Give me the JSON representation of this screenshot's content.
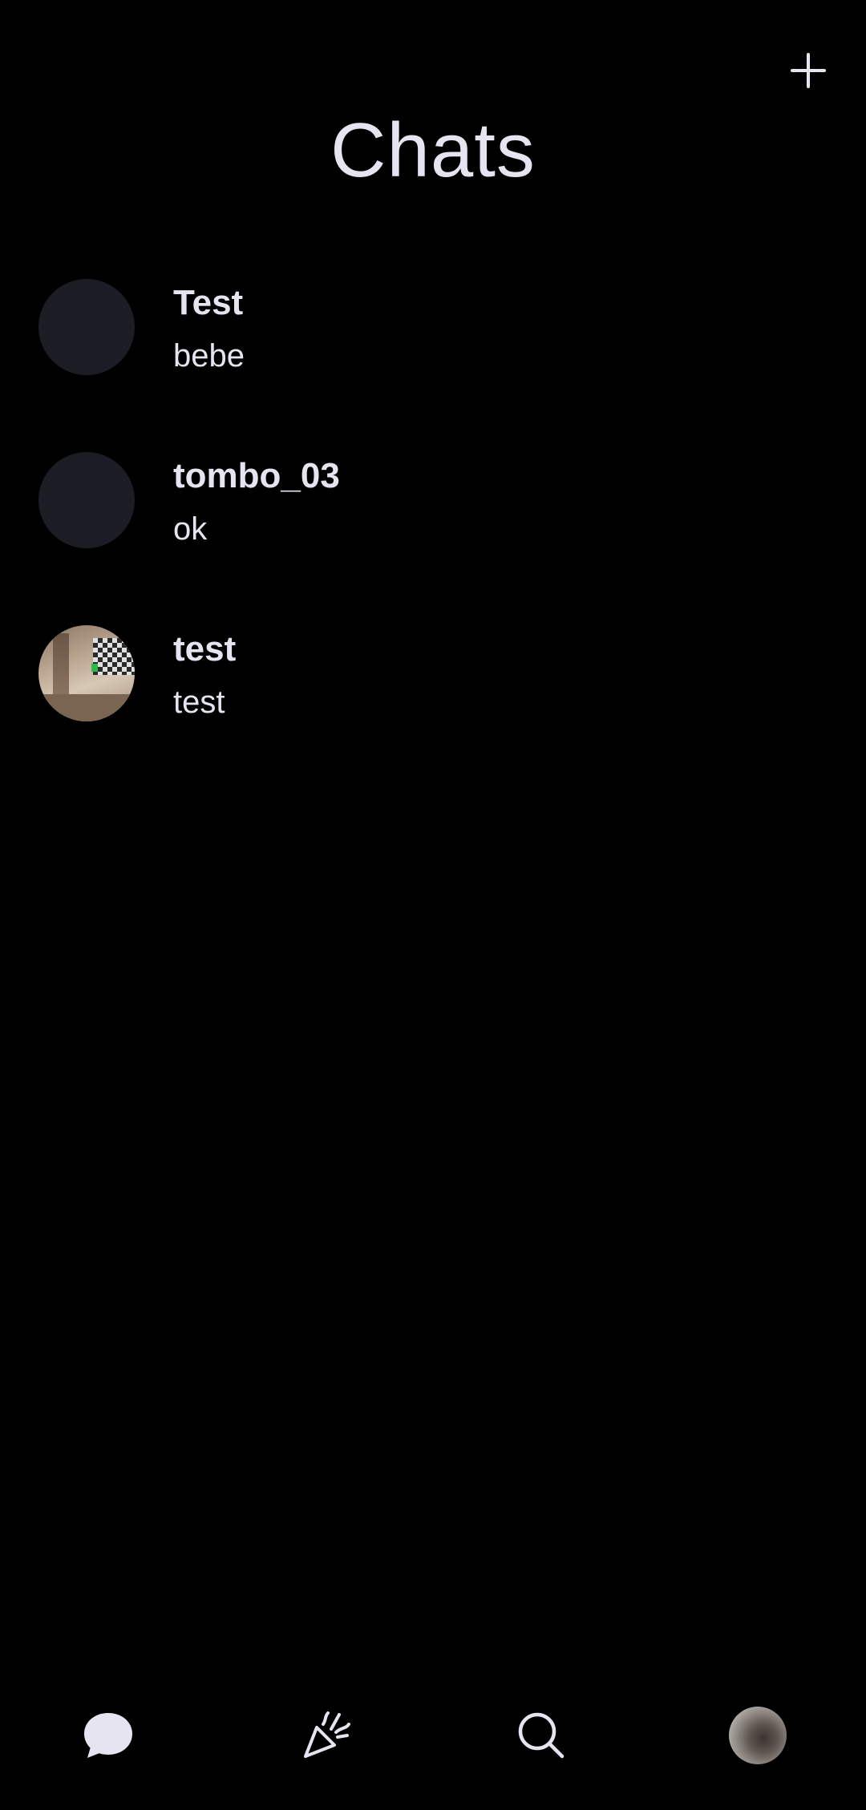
{
  "header": {
    "title": "Chats",
    "add_icon": "plus-icon"
  },
  "chats": [
    {
      "name": "Test",
      "preview": "bebe",
      "avatar": "placeholder"
    },
    {
      "name": "tombo_03",
      "preview": "ok",
      "avatar": "placeholder"
    },
    {
      "name": "test",
      "preview": "test",
      "avatar": "photo"
    }
  ],
  "bottom_nav": {
    "items": [
      {
        "id": "chats",
        "icon": "chat-bubble-icon",
        "active": true
      },
      {
        "id": "events",
        "icon": "party-popper-icon",
        "active": false
      },
      {
        "id": "search",
        "icon": "search-icon",
        "active": false
      },
      {
        "id": "profile",
        "icon": "profile-avatar",
        "active": false
      }
    ]
  },
  "colors": {
    "background": "#000000",
    "text": "#e6e4f0",
    "avatar_placeholder": "#1c1c24"
  }
}
